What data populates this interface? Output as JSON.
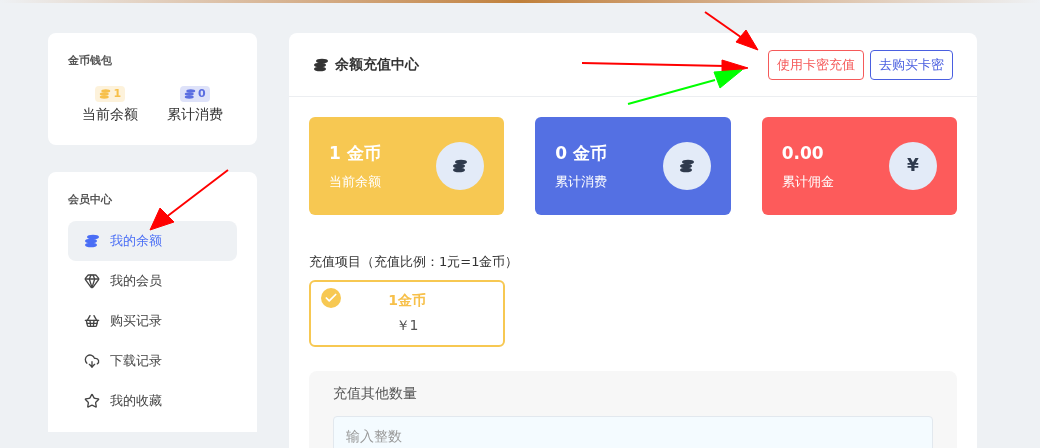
{
  "wallet": {
    "title": "金币钱包",
    "stats": [
      {
        "badge": "1",
        "label": "当前余额",
        "color": "#f7c04a"
      },
      {
        "badge": "0",
        "label": "累计消费",
        "color": "#5b6ee1"
      }
    ]
  },
  "member_center": {
    "title": "会员中心",
    "items": [
      {
        "label": "我的余额",
        "selected": true
      },
      {
        "label": "我的会员",
        "selected": false
      },
      {
        "label": "购买记录",
        "selected": false
      },
      {
        "label": "下载记录",
        "selected": false
      },
      {
        "label": "我的收藏",
        "selected": false
      }
    ]
  },
  "main": {
    "title": "余额充值中心",
    "buttons": [
      {
        "label": "使用卡密充值",
        "color": "#f55a5a"
      },
      {
        "label": "去购买卡密",
        "color": "#4a5fe0"
      }
    ],
    "stat_cards": [
      {
        "value": "1 金币",
        "label": "当前余额",
        "color": "#f7c852"
      },
      {
        "value": "0 金币",
        "label": "累计消费",
        "color": "#5470e3"
      },
      {
        "value": "0.00",
        "label": "累计佣金",
        "color": "#fd5b5b",
        "symbol": "¥"
      }
    ],
    "recharge_label": "充值项目（充值比例：1元=1金币）",
    "options": [
      {
        "coins": "1金币",
        "price": "￥1",
        "selected": true
      }
    ],
    "other": {
      "title": "充值其他数量",
      "placeholder": "输入整数"
    }
  }
}
